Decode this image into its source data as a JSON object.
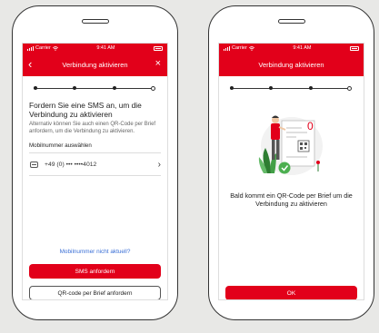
{
  "colors": {
    "brand_red": "#e2001a",
    "link_blue": "#3a6fd6",
    "background": "#e8e8e6"
  },
  "statusbar": {
    "carrier": "Carrier",
    "time": "9:41 AM"
  },
  "left": {
    "nav_title": "Verbindung aktivieren",
    "heading": "Fordern Sie eine SMS an, um die Verbindung zu aktivieren",
    "description": "Alternativ können Sie auch einen QR-Code per Brief anfordern, um die Verbindung zu aktivieren.",
    "section_label": "Mobilnummer auswählen",
    "phone_number": "+49 (0) ••• ••••4012",
    "link": "Mobilnummer nicht aktuell?",
    "primary_button": "SMS anfordern",
    "secondary_button": "QR-code per Brief anfordern",
    "icons": {
      "back": "chevron-left-icon",
      "close": "close-icon",
      "message": "message-icon",
      "chevron": "chevron-right-icon"
    }
  },
  "right": {
    "nav_title": "Verbindung aktivieren",
    "message": "Bald kommt ein QR-Code per Brief um die Verbindung zu aktivieren",
    "button": "OK"
  }
}
